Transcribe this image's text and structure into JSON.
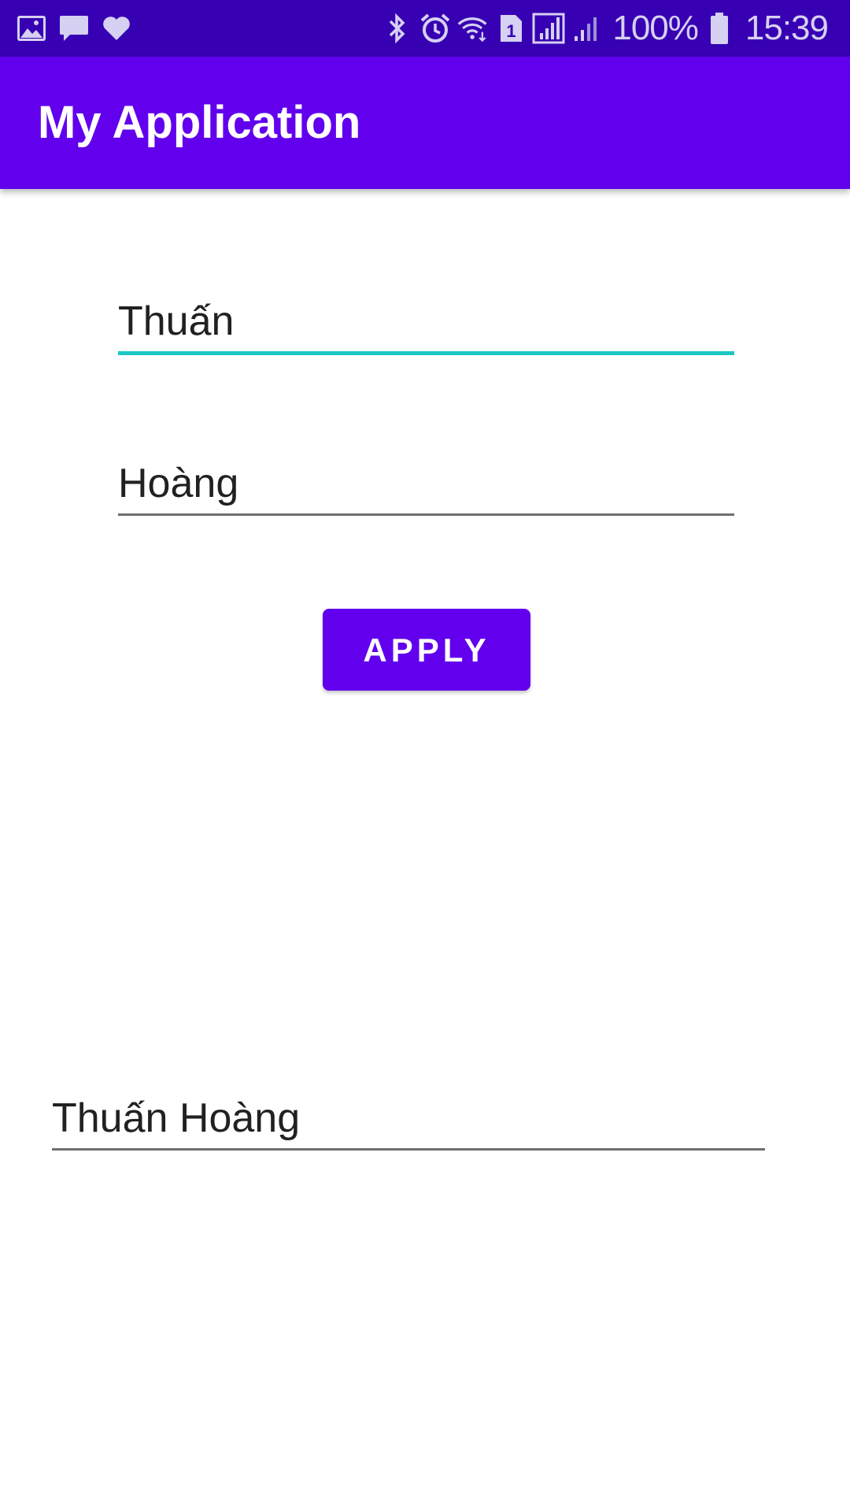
{
  "status_bar": {
    "battery_percent": "100%",
    "time": "15:39",
    "left_icons": [
      "image-icon",
      "chat-bubble-icon",
      "heart-icon"
    ],
    "right_icons": [
      "bluetooth-icon",
      "alarm-icon",
      "wifi-icon",
      "sim-1-icon",
      "signal-icon",
      "signal-weak-icon",
      "battery-icon"
    ],
    "background_color": "#3700B3"
  },
  "app_bar": {
    "title": "My Application",
    "background_color": "#6200EE"
  },
  "form": {
    "first_field_value": "Thuấn",
    "second_field_value": "Hoàng",
    "focused_underline_color": "#1CC8C4"
  },
  "actions": {
    "apply_label": "APPLY",
    "apply_color": "#6200EE"
  },
  "result": {
    "text": "Thuấn Hoàng"
  }
}
